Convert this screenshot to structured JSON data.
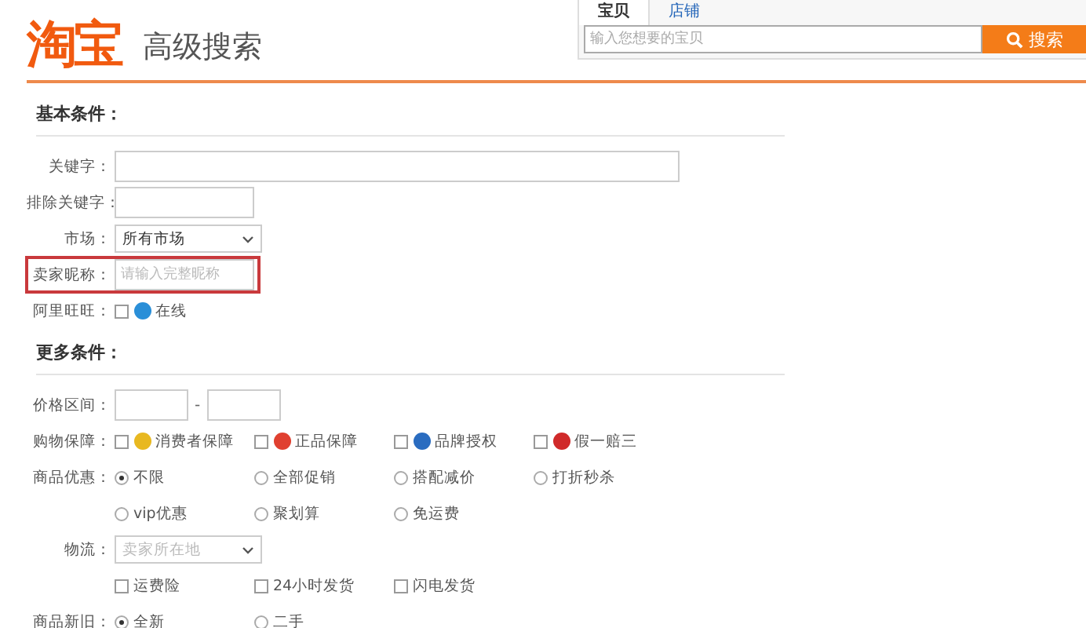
{
  "header": {
    "logo": "淘宝",
    "title": "高级搜索"
  },
  "search": {
    "tabs": [
      {
        "label": "宝贝",
        "selected": true
      },
      {
        "label": "店铺",
        "selected": false
      }
    ],
    "placeholder": "输入您想要的宝贝",
    "button": "搜索"
  },
  "sections": [
    {
      "title": "基本条件：",
      "rows": [
        {
          "kind": "longtext",
          "label": "关键字："
        },
        {
          "kind": "text",
          "label": "排除关键字："
        },
        {
          "kind": "select",
          "label": "市场：",
          "value": "所有市场"
        },
        {
          "kind": "text",
          "label": "卖家昵称：",
          "placeholder": "请输入完整昵称",
          "highlighted": true
        },
        {
          "kind": "checks",
          "label": "阿里旺旺：",
          "options": [
            {
              "label": "在线",
              "checked": false,
              "color": "#2a8fd8"
            }
          ]
        }
      ]
    },
    {
      "title": "更多条件：",
      "rows": [
        {
          "kind": "range",
          "label": "价格区间：",
          "separator": "-"
        },
        {
          "kind": "checks",
          "label": "购物保障：",
          "options": [
            {
              "label": "消费者保障",
              "checked": false,
              "color": "#e8b820"
            },
            {
              "label": "正品保障",
              "checked": false,
              "color": "#e04030"
            },
            {
              "label": "品牌授权",
              "checked": false,
              "color": "#2a6cc0"
            },
            {
              "label": "假一赔三",
              "checked": false,
              "color": "#d02a2a"
            }
          ]
        },
        {
          "kind": "radios",
          "label": "商品优惠：",
          "options": [
            {
              "label": "不限",
              "selected": true
            },
            {
              "label": "全部促销",
              "selected": false
            },
            {
              "label": "搭配减价",
              "selected": false
            },
            {
              "label": "打折秒杀",
              "selected": false
            }
          ]
        },
        {
          "kind": "radios",
          "options": [
            {
              "label": "vip优惠",
              "selected": false
            },
            {
              "label": "聚划算",
              "selected": false
            },
            {
              "label": "免运费",
              "selected": false
            }
          ]
        },
        {
          "kind": "select",
          "label": "物流：",
          "placeholder": "卖家所在地"
        },
        {
          "kind": "checks",
          "options": [
            {
              "label": "运费险",
              "checked": false
            },
            {
              "label": "24小时发货",
              "checked": false
            },
            {
              "label": "闪电发货",
              "checked": false
            }
          ]
        },
        {
          "kind": "radios",
          "label": "商品新旧：",
          "options": [
            {
              "label": "全新",
              "selected": true
            },
            {
              "label": "二手",
              "selected": false
            }
          ]
        }
      ]
    }
  ]
}
